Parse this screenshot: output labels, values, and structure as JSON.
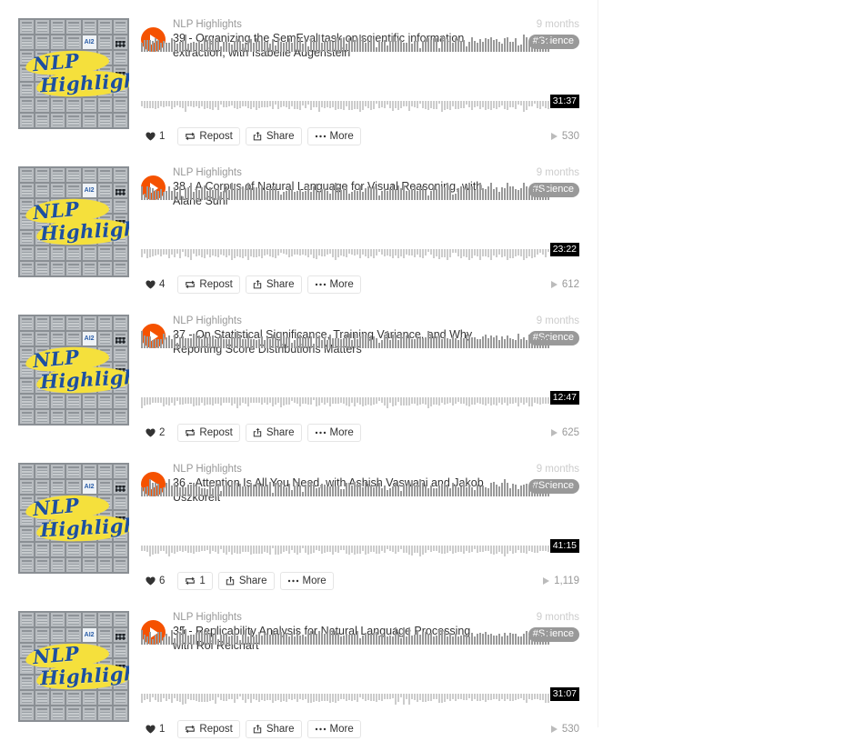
{
  "theme": {
    "accent": "#f55200",
    "title_color": "#333333",
    "muted_color": "#999999",
    "tag_bg": "#999999",
    "wave_top": "#999999",
    "wave_bottom": "#cccccc",
    "duration_bg": "#000000"
  },
  "artwork": {
    "line1": "NLP",
    "line2": "Highlights",
    "logo_tile": "AI2"
  },
  "icons": {
    "play": "play-icon",
    "heart": "heart-icon",
    "repost": "repost-icon",
    "share": "share-icon",
    "more": "more-icon",
    "plays": "play-count-icon"
  },
  "labels": {
    "repost": "Repost",
    "share": "Share",
    "more": "More"
  },
  "stream": {
    "items": [
      {
        "username": "NLP Highlights",
        "title": "39 - Organizing the SemEval task on scientific information extraction, with Isabelle Augenstein",
        "time_ago": "9 months",
        "tag": "#Science",
        "duration": "31:37",
        "likes": "1",
        "repost_label": "Repost",
        "share_label": "Share",
        "more_label": "More",
        "plays": "530"
      },
      {
        "username": "NLP Highlights",
        "title": "38 - A Corpus of Natural Language for Visual Reasoning, with Alane Suhr",
        "time_ago": "9 months",
        "tag": "#Science",
        "duration": "23:22",
        "likes": "4",
        "repost_label": "Repost",
        "share_label": "Share",
        "more_label": "More",
        "plays": "612"
      },
      {
        "username": "NLP Highlights",
        "title": "37 - On Statistical Significance, Training Variance, and Why Reporting Score Distributions Matters",
        "time_ago": "9 months",
        "tag": "#Science",
        "duration": "12:47",
        "likes": "2",
        "repost_label": "Repost",
        "share_label": "Share",
        "more_label": "More",
        "plays": "625"
      },
      {
        "username": "NLP Highlights",
        "title": "36 - Attention Is All You Need, with Ashish Vaswani and Jakob Uszkoreit",
        "time_ago": "9 months",
        "tag": "#Science",
        "duration": "41:15",
        "likes": "6",
        "repost_label": "1",
        "share_label": "Share",
        "more_label": "More",
        "plays": "1,119"
      },
      {
        "username": "NLP Highlights",
        "title": "35 - Replicability Analysis for Natural Language Processing, with Roi Reichart",
        "time_ago": "9 months",
        "tag": "#Science",
        "duration": "31:07",
        "likes": "1",
        "repost_label": "Repost",
        "share_label": "Share",
        "more_label": "More",
        "plays": "530"
      }
    ]
  }
}
